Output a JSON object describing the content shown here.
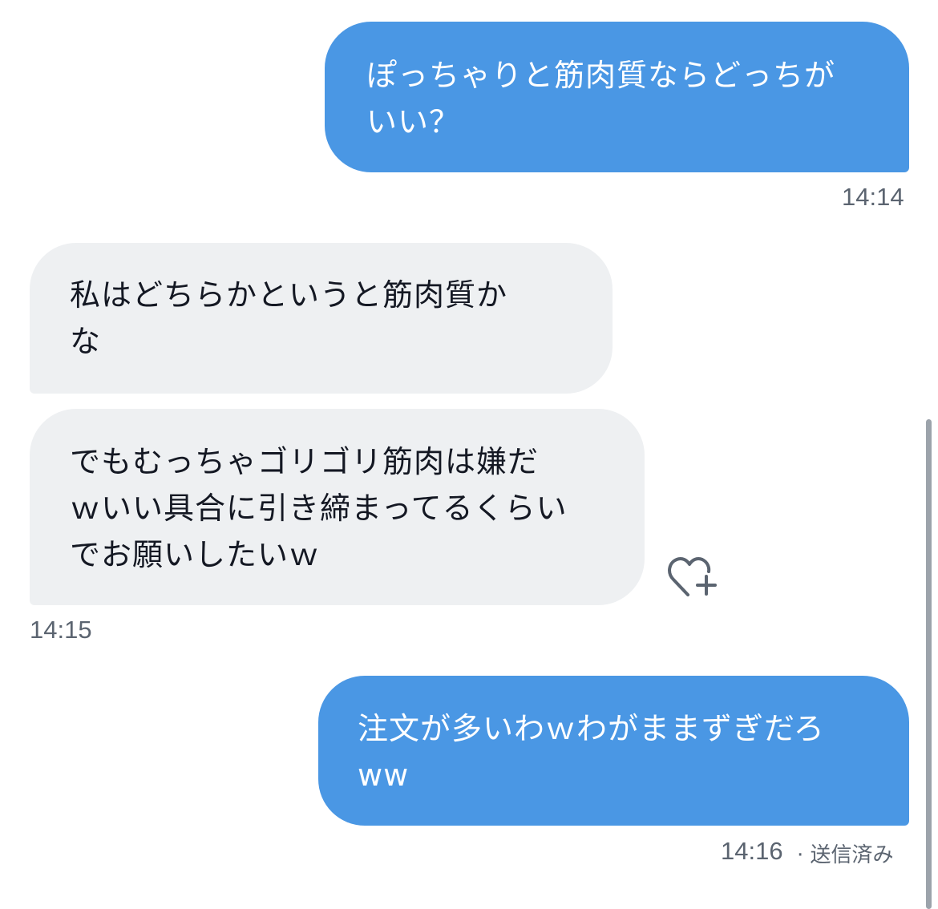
{
  "conversation": {
    "messages": [
      {
        "direction": "sent",
        "lines": [
          "ぽっちゃりと筋肉質ならどっちが",
          "いい？"
        ],
        "time": "14:14"
      },
      {
        "direction": "received",
        "lines": [
          "私はどちらかというと筋肉質か",
          "な"
        ]
      },
      {
        "direction": "received",
        "lines": [
          "でもむっちゃゴリゴリ筋肉は嫌だ",
          "ｗいい具合に引き締まってるくらい",
          "でお願いしたいｗ"
        ],
        "time": "14:15"
      },
      {
        "direction": "sent",
        "lines": [
          "注文が多いわｗわがままずぎだろ",
          "ww"
        ],
        "time": "14:16",
        "status": "· 送信済み"
      }
    ]
  },
  "icons": {
    "reaction": "heart-plus-icon"
  },
  "colors": {
    "sent_bubble": "#4a97e4",
    "received_bubble": "#eef0f2",
    "timestamp": "#5b6470"
  }
}
